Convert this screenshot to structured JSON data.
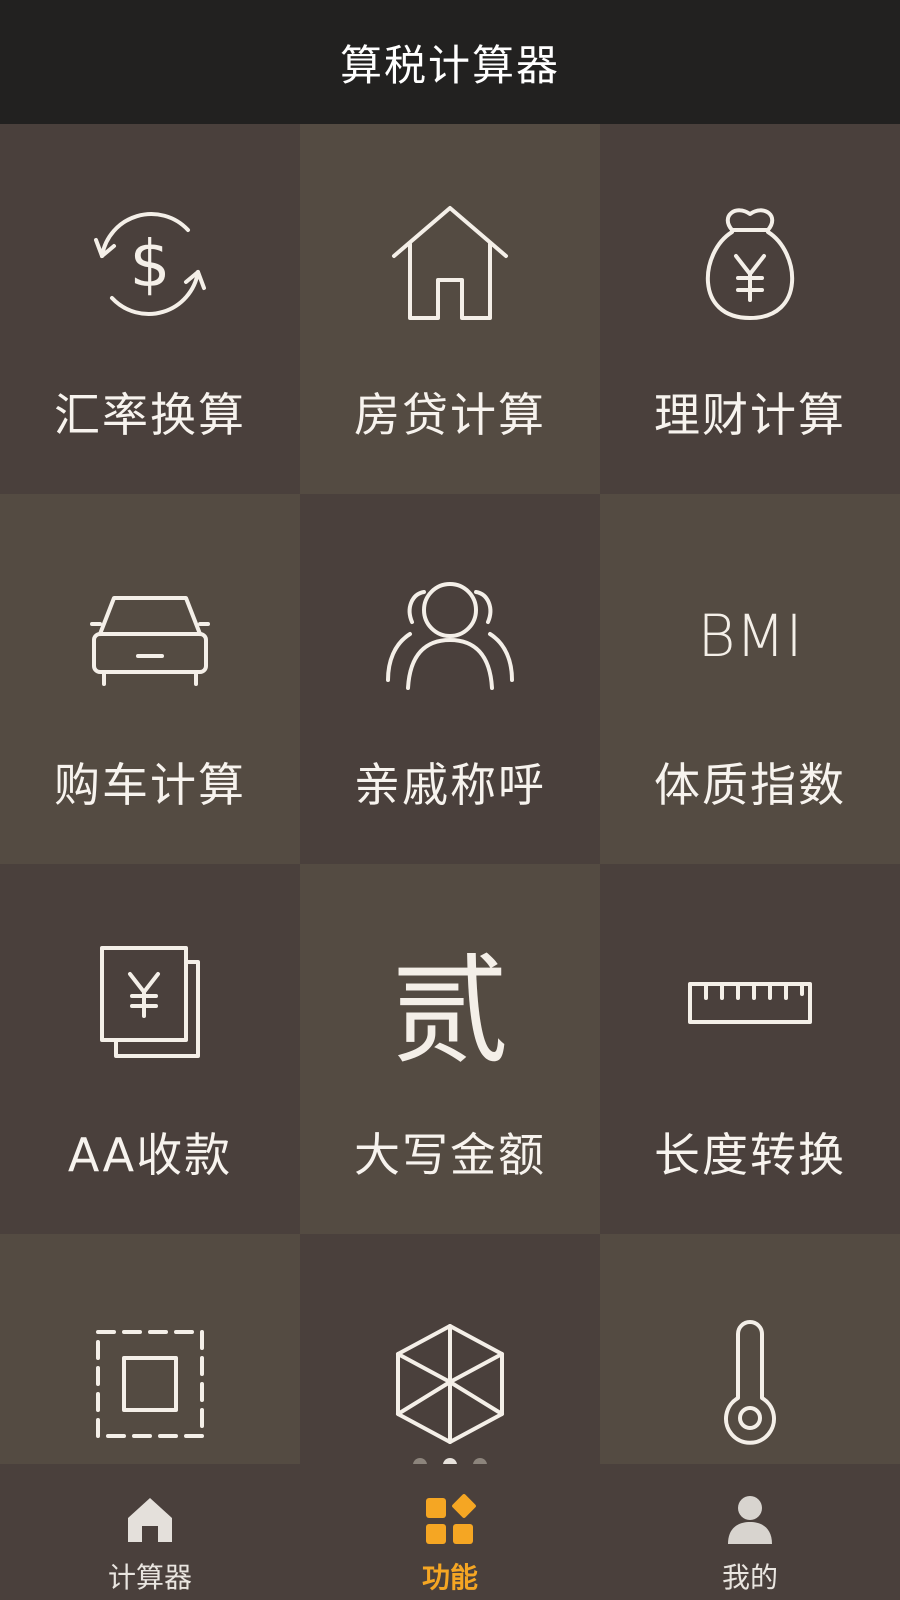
{
  "header": {
    "title": "算税计算器"
  },
  "tiles": [
    {
      "label": "汇率换算",
      "icon": "currency-exchange-icon"
    },
    {
      "label": "房贷计算",
      "icon": "house-icon"
    },
    {
      "label": "理财计算",
      "icon": "money-bag-yuan-icon"
    },
    {
      "label": "购车计算",
      "icon": "car-icon"
    },
    {
      "label": "亲戚称呼",
      "icon": "people-group-icon"
    },
    {
      "label": "体质指数",
      "icon": "bmi-icon",
      "icon_text": "BMI"
    },
    {
      "label": "AA收款",
      "icon": "yuan-cards-icon"
    },
    {
      "label": "大写金额",
      "icon": "capital-numeral-icon",
      "icon_text": "贰"
    },
    {
      "label": "长度转换",
      "icon": "ruler-icon"
    },
    {
      "label": "",
      "icon": "area-square-icon"
    },
    {
      "label": "",
      "icon": "cube-icon"
    },
    {
      "label": "",
      "icon": "thermometer-icon"
    }
  ],
  "page_indicator": {
    "count": 3,
    "active": 2
  },
  "tabbar": {
    "items": [
      {
        "label": "计算器",
        "icon": "home-icon",
        "active": false
      },
      {
        "label": "功能",
        "icon": "grid-apps-icon",
        "active": true
      },
      {
        "label": "我的",
        "icon": "user-icon",
        "active": false
      }
    ],
    "active_color": "#f5a623"
  },
  "colors": {
    "header_bg": "#222120",
    "tile_dark": "#4a403c",
    "tile_light": "#544b42"
  }
}
